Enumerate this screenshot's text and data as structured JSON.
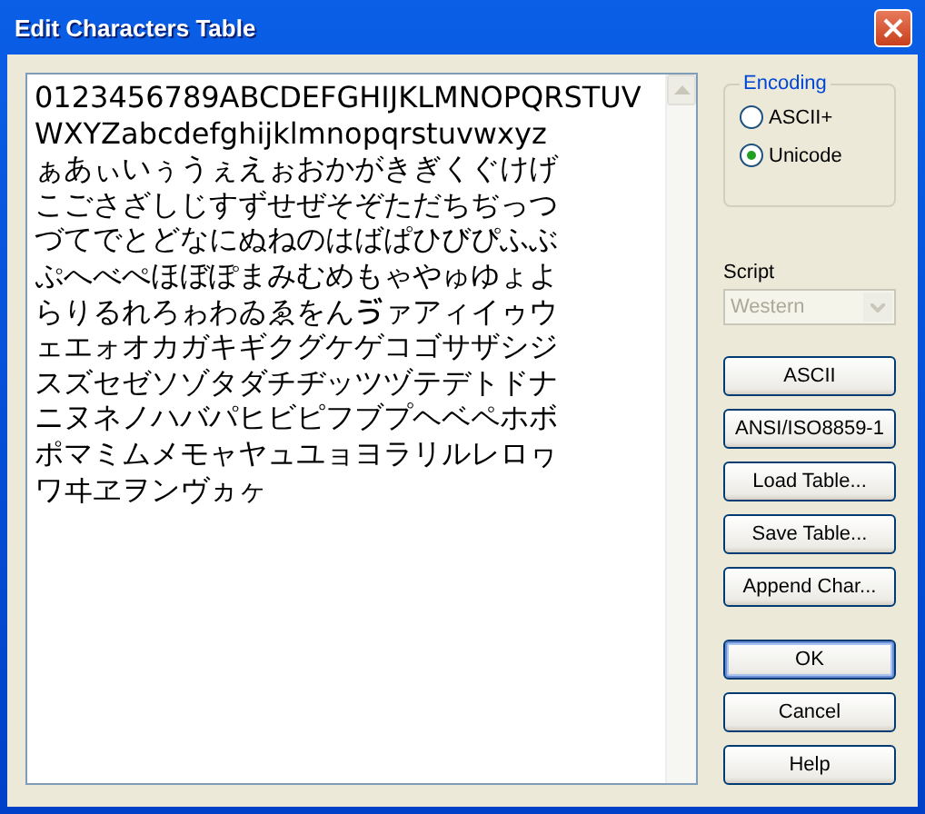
{
  "window": {
    "title": "Edit Characters Table"
  },
  "text_lines": [
    "0123456789ABCDEFGHIJKLMNOPQRSTUV",
    "WXYZabcdefghijklmnopqrstuvwxyz",
    "ぁあぃいぅうぇえぉおかがきぎくぐけげ",
    "こごさざしじすずせぜそぞただちぢっつ",
    "づてでとどなにぬねのはばぱひびぴふぶ",
    "ぷへべぺほぼぽまみむめもゃやゅゆょよ",
    "らりるれろゎわゐゑをんゔァアィイゥウ",
    "ェエォオカガキギクグケゲコゴサザシジ",
    "スズセゼソゾタダチヂッツヅテデトドナ",
    "ニヌネノハバパヒビピフブプヘベペホボ",
    "ポマミムメモャヤュユョヨラリルレロヮ",
    "ワヰヱヲンヴヵヶ"
  ],
  "encoding": {
    "label": "Encoding",
    "options": [
      {
        "label": "ASCII+",
        "selected": false
      },
      {
        "label": "Unicode",
        "selected": true
      }
    ]
  },
  "script": {
    "label": "Script",
    "value": "Western",
    "disabled": true
  },
  "tool_buttons": [
    "ASCII",
    "ANSI/ISO8859-1",
    "Load Table...",
    "Save Table...",
    "Append Char..."
  ],
  "dialog_buttons": [
    {
      "label": "OK",
      "default": true
    },
    {
      "label": "Cancel",
      "default": false
    },
    {
      "label": "Help",
      "default": false
    }
  ]
}
